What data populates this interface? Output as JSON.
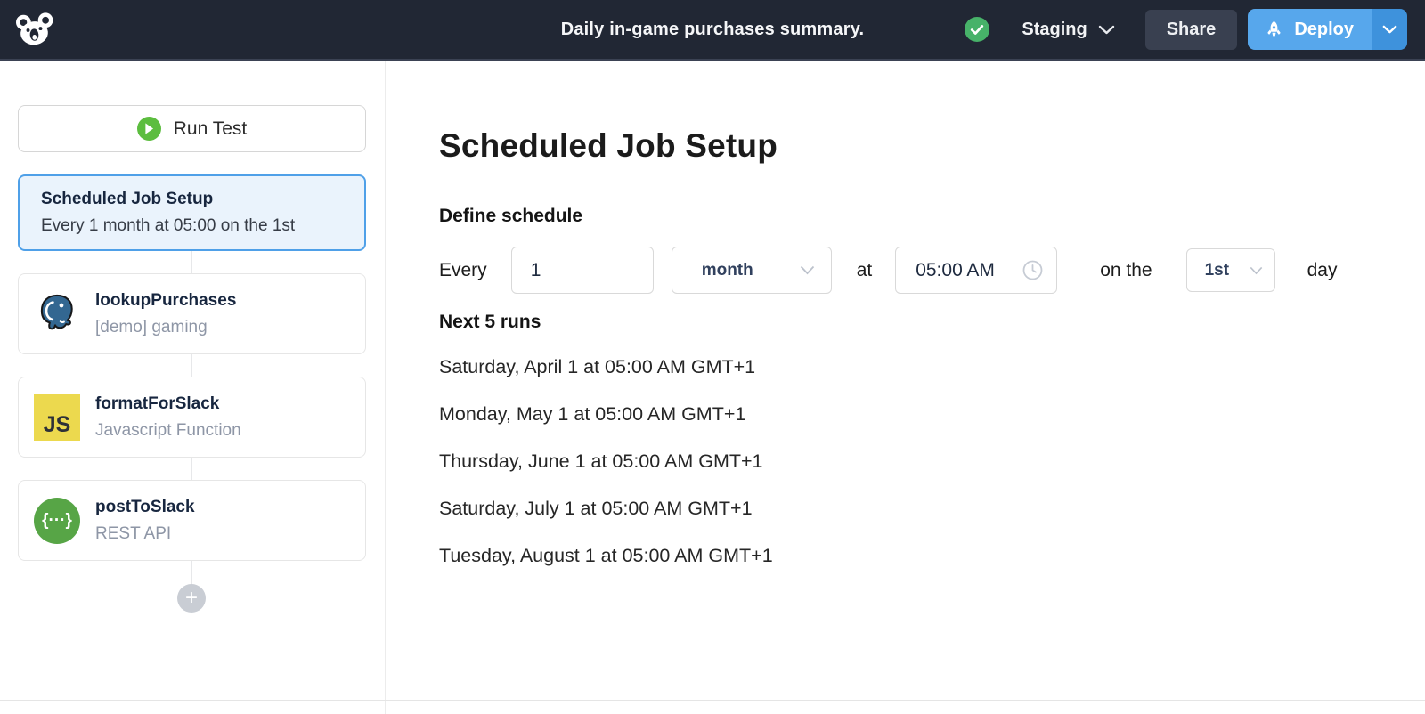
{
  "topbar": {
    "title": "Daily in-game purchases summary.",
    "environment": "Staging",
    "share_label": "Share",
    "deploy_label": "Deploy",
    "status": "success"
  },
  "sidebar": {
    "run_test_label": "Run Test",
    "steps": [
      {
        "title": "Scheduled Job Setup",
        "subtitle": "Every 1 month at 05:00 on the 1st",
        "icon": "none",
        "selected": true
      },
      {
        "title": "lookupPurchases",
        "subtitle": "[demo] gaming",
        "icon": "postgresql-icon",
        "selected": false
      },
      {
        "title": "formatForSlack",
        "subtitle": "Javascript Function",
        "icon": "javascript-icon",
        "selected": false
      },
      {
        "title": "postToSlack",
        "subtitle": "REST API",
        "icon": "rest-api-icon",
        "selected": false
      }
    ],
    "js_icon_text": "JS",
    "rest_icon_text": "{···}",
    "add_step_glyph": "+"
  },
  "main": {
    "title": "Scheduled Job Setup",
    "define_schedule_label": "Define schedule",
    "schedule_form": {
      "every_label": "Every",
      "interval_value": "1",
      "unit_value": "month",
      "at_label": "at",
      "time_value": "05:00 AM",
      "on_the_label": "on the",
      "day_value": "1st",
      "day_label": "day"
    },
    "next_runs_label": "Next 5 runs",
    "next_runs": [
      "Saturday, April 1 at 05:00 AM GMT+1",
      "Monday, May 1 at 05:00 AM GMT+1",
      "Thursday, June 1 at 05:00 AM GMT+1",
      "Saturday, July 1 at 05:00 AM GMT+1",
      "Tuesday, August 1 at 05:00 AM GMT+1"
    ]
  },
  "colors": {
    "topbar_bg": "#212734",
    "accent_blue": "#4fa0e8",
    "deploy_blue": "#57a7ec",
    "deploy_caret_blue": "#3e92dc",
    "share_gray": "#394050",
    "status_green": "#47b269",
    "play_green": "#5cbd3f",
    "postgres_blue": "#336791",
    "js_yellow": "#ecd94e",
    "rest_green": "#57a546",
    "selected_card_bg": "#eaf3fc"
  }
}
